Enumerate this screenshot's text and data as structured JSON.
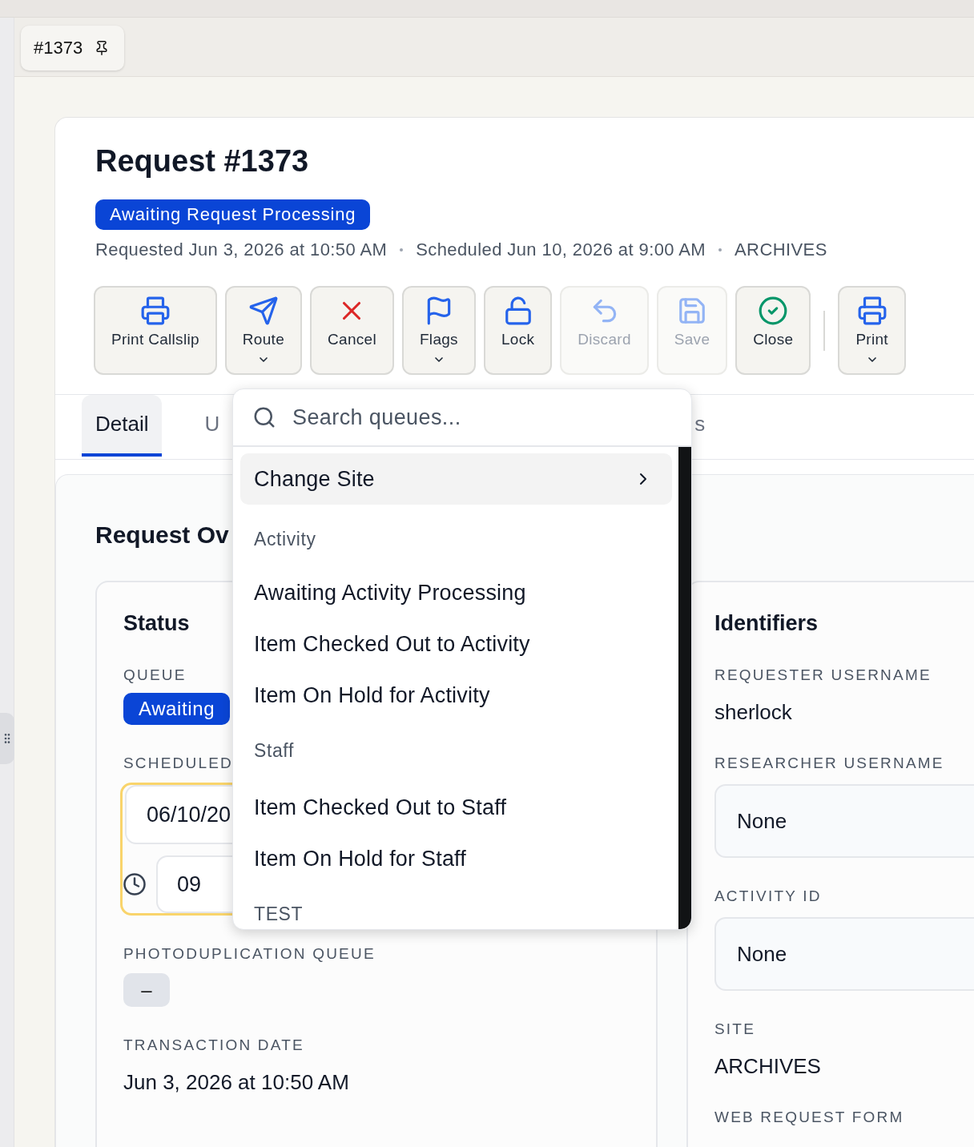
{
  "tab_chip": {
    "label": "#1373",
    "pinned": true
  },
  "request": {
    "title": "Request #1373",
    "status": "Awaiting Request Processing",
    "requested": "Requested Jun 3, 2026 at 10:50 AM",
    "scheduled": "Scheduled Jun 10, 2026 at 9:00 AM",
    "site": "ARCHIVES"
  },
  "toolbar": [
    {
      "kind": "print",
      "label": "Print Callslip",
      "disabled": false,
      "menu": false
    },
    {
      "kind": "route",
      "label": "Route",
      "disabled": false,
      "menu": true
    },
    {
      "kind": "cancel",
      "label": "Cancel",
      "disabled": false,
      "menu": false
    },
    {
      "kind": "flags",
      "label": "Flags",
      "disabled": false,
      "menu": true
    },
    {
      "kind": "lock",
      "label": "Lock",
      "disabled": false,
      "menu": false
    },
    {
      "kind": "discard",
      "label": "Discard",
      "disabled": true,
      "menu": false
    },
    {
      "kind": "save",
      "label": "Save",
      "disabled": true,
      "menu": false
    },
    {
      "kind": "close",
      "label": "Close",
      "disabled": false,
      "menu": false
    },
    {
      "kind": "separator"
    },
    {
      "kind": "print",
      "label": "Print",
      "disabled": false,
      "menu": true
    }
  ],
  "tabs": [
    {
      "label": "Detail",
      "selected": true
    },
    {
      "label": "U",
      "selected": false
    },
    {
      "label": "s",
      "selected": false
    }
  ],
  "overview": {
    "heading": "Request Ov",
    "status": {
      "title": "Status",
      "fields": [
        {
          "kind": "badge",
          "label": "QUEUE",
          "value": "Awaiting"
        },
        {
          "kind": "datetime",
          "label": "SCHEDULED",
          "date": "06/10/20",
          "time": "09",
          "focused": true
        },
        {
          "kind": "chip",
          "label": "PHOTODUPLICATION QUEUE",
          "value": "–"
        },
        {
          "kind": "text",
          "label": "TRANSACTION DATE",
          "value": "Jun 3, 2026 at 10:50 AM"
        }
      ]
    },
    "identifiers": {
      "title": "Identifiers",
      "fields": [
        {
          "kind": "text",
          "label": "REQUESTER USERNAME",
          "value": "sherlock"
        },
        {
          "kind": "input",
          "label": "RESEARCHER USERNAME",
          "value": "None"
        },
        {
          "kind": "input",
          "label": "ACTIVITY ID",
          "value": "None"
        },
        {
          "kind": "text",
          "label": "SITE",
          "value": "ARCHIVES"
        },
        {
          "kind": "label",
          "label": "WEB REQUEST FORM"
        }
      ]
    }
  },
  "queue_menu": {
    "placeholder": "Search queues...",
    "entries": [
      {
        "kind": "submenu",
        "label": "Change Site",
        "highlighted": true
      },
      {
        "kind": "heading",
        "label": "Activity"
      },
      {
        "kind": "option",
        "label": "Awaiting Activity Processing",
        "highlighted": false
      },
      {
        "kind": "option",
        "label": "Item Checked Out to Activity",
        "highlighted": false
      },
      {
        "kind": "option",
        "label": "Item On Hold for Activity",
        "highlighted": false
      },
      {
        "kind": "heading",
        "label": "Staff"
      },
      {
        "kind": "option",
        "label": "Item Checked Out to Staff",
        "highlighted": false
      },
      {
        "kind": "option",
        "label": "Item On Hold for Staff",
        "highlighted": false
      },
      {
        "kind": "heading",
        "label": "TEST"
      }
    ]
  }
}
